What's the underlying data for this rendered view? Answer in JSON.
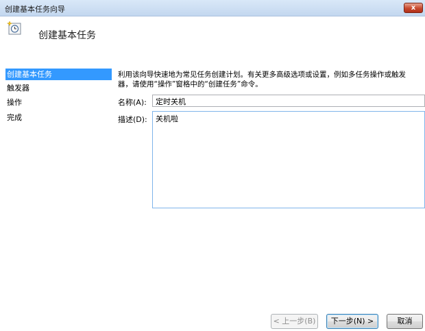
{
  "window": {
    "title": "创建基本任务向导",
    "close_label": "x"
  },
  "header": {
    "title": "创建基本任务",
    "icon": "task-clock-icon"
  },
  "sidebar": {
    "items": [
      {
        "label": "创建基本任务",
        "active": true
      },
      {
        "label": "触发器",
        "active": false
      },
      {
        "label": "操作",
        "active": false
      },
      {
        "label": "完成",
        "active": false
      }
    ]
  },
  "main": {
    "description_line1": "利用该向导快速地为常见任务创建计划。有关更多高级选项或设置，例如多任务操作或触发",
    "description_line2": "器，请使用“操作”窗格中的“创建任务”命令。",
    "name_label": "名称(A):",
    "name_value": "定时关机",
    "desc_label": "描述(D):",
    "desc_value": "关机啦"
  },
  "footer": {
    "back_label": "< 上一步(B)",
    "next_label": "下一步(N) >",
    "cancel_label": "取消"
  },
  "colors": {
    "selection": "#3399ff",
    "titlebar": "#c3d7ef",
    "close": "#c8492d"
  }
}
